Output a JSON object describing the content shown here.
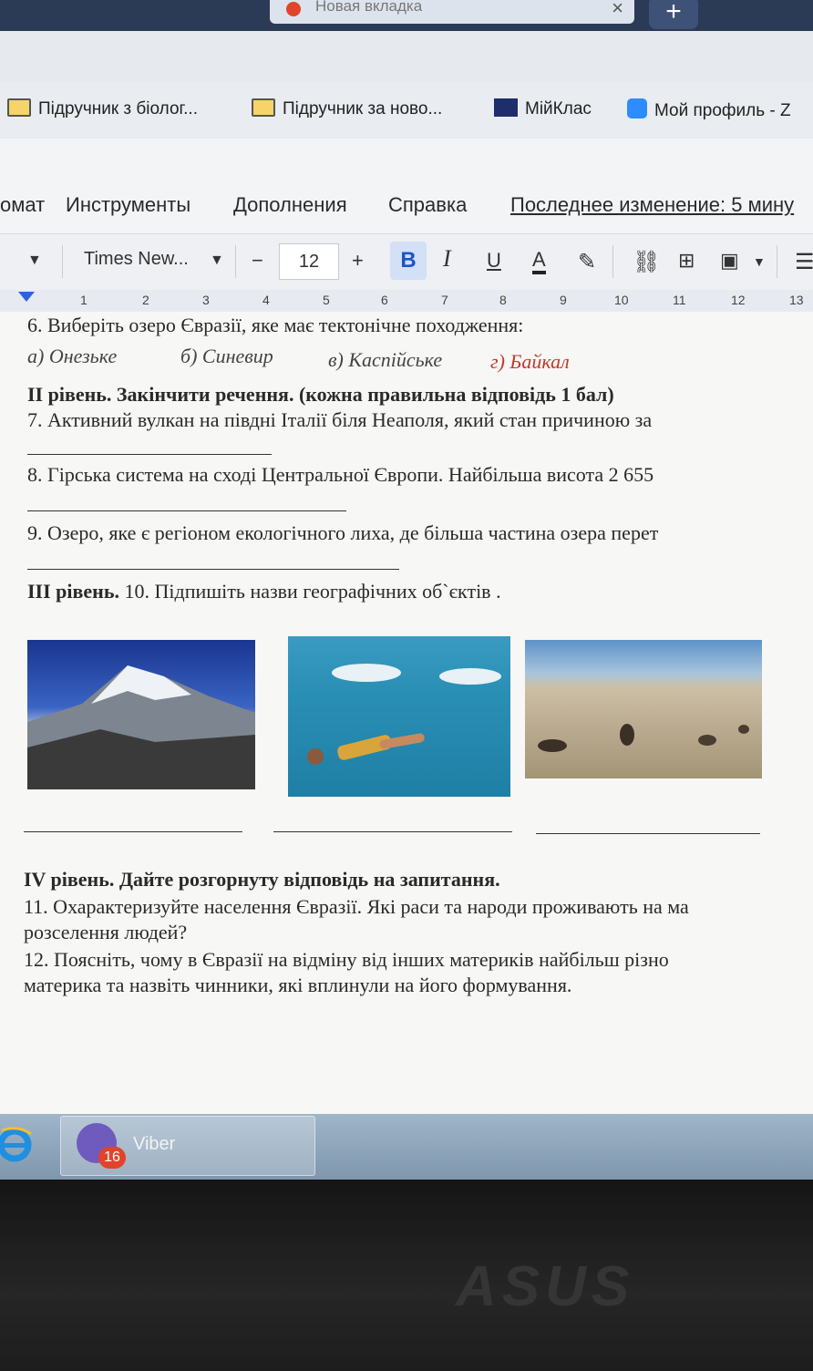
{
  "browser": {
    "tab_title": "Новая вкладка",
    "tab_close": "×",
    "new_tab": "+"
  },
  "bookmarks": [
    {
      "label": "Підручник з біолог...",
      "icon": "book-icon"
    },
    {
      "label": "Підручник за ново...",
      "icon": "book-icon"
    },
    {
      "label": "МійКлас",
      "icon": "miyklas-icon"
    },
    {
      "label": "Мой профиль - Z",
      "icon": "zoom-icon"
    }
  ],
  "menu": {
    "format": "омат",
    "tools": "Инструменты",
    "addons": "Дополнения",
    "help": "Справка",
    "last_edit": "Последнее изменение: 5 мину"
  },
  "toolbar": {
    "font_name": "Times New...",
    "font_size": "12",
    "minus": "−",
    "plus": "+",
    "bold": "B",
    "italic": "I",
    "underline": "U",
    "text_color": "A"
  },
  "ruler": [
    "1",
    "2",
    "3",
    "4",
    "5",
    "6",
    "7",
    "8",
    "9",
    "10",
    "11",
    "12",
    "13"
  ],
  "doc": {
    "q6": "6. Виберіть озеро Євразії, яке має тектонічне походження:",
    "q6_a": "а) Онезьке",
    "q6_b": "б) Синевир",
    "q6_c": "в) Каспійське",
    "q6_d": "г) Байкал",
    "level2": "ІІ рівень. Закінчити речення. (кожна правильна відповідь 1 бал)",
    "q7": "7. Активний вулкан на півдні Італії біля Неаполя, який стан причиною за",
    "q8": "8. Гірська система на сході Центральної Європи. Найбільша висота 2 655",
    "q9": "9. Озеро, яке є регіоном екологічного лиха, де більша частина озера перет",
    "level3_bold": "ІІІ рівень.",
    "level3_text": " 10. Підпишіть назви географічних об`єктів .",
    "level4": "IV рівень. Дайте розгорнуту відповідь на запитання.",
    "q11_line1": "11. Охарактеризуйте населення Євразії. Які раси та народи проживають на ма",
    "q11_line2": "розселення людей?",
    "q12_line1": "12. Поясніть, чому в Євразії на відміну від інших материків найбільш різно",
    "q12_line2": "материка та назвіть чинники, які вплинули на його формування."
  },
  "taskbar": {
    "viber_label": "Viber",
    "viber_badge": "16"
  },
  "laptop_brand": "ASUS"
}
